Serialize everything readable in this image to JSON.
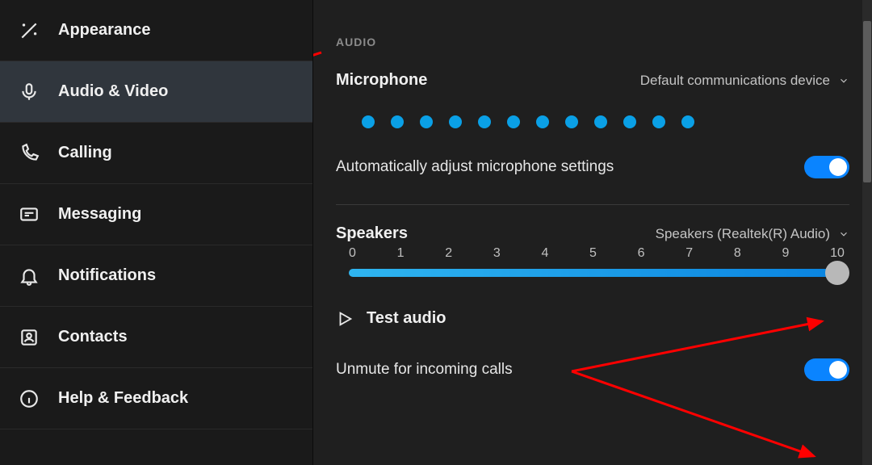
{
  "sidebar": {
    "items": [
      {
        "label": "Appearance"
      },
      {
        "label": "Audio & Video"
      },
      {
        "label": "Calling"
      },
      {
        "label": "Messaging"
      },
      {
        "label": "Notifications"
      },
      {
        "label": "Contacts"
      },
      {
        "label": "Help & Feedback"
      }
    ],
    "active_index": 1
  },
  "audio": {
    "section_title": "AUDIO",
    "microphone_label": "Microphone",
    "microphone_device": "Default communications device",
    "mic_level_dots": 12,
    "auto_adjust_label": "Automatically adjust microphone settings",
    "auto_adjust_on": true,
    "speakers_label": "Speakers",
    "speakers_device": "Speakers (Realtek(R) Audio)",
    "volume_ticks": [
      "0",
      "1",
      "2",
      "3",
      "4",
      "5",
      "6",
      "7",
      "8",
      "9",
      "10"
    ],
    "volume_value": 10,
    "test_audio_label": "Test audio",
    "unmute_label": "Unmute for incoming calls",
    "unmute_on": true
  },
  "colors": {
    "accent": "#0a84ff",
    "dot": "#0aa0e6"
  }
}
